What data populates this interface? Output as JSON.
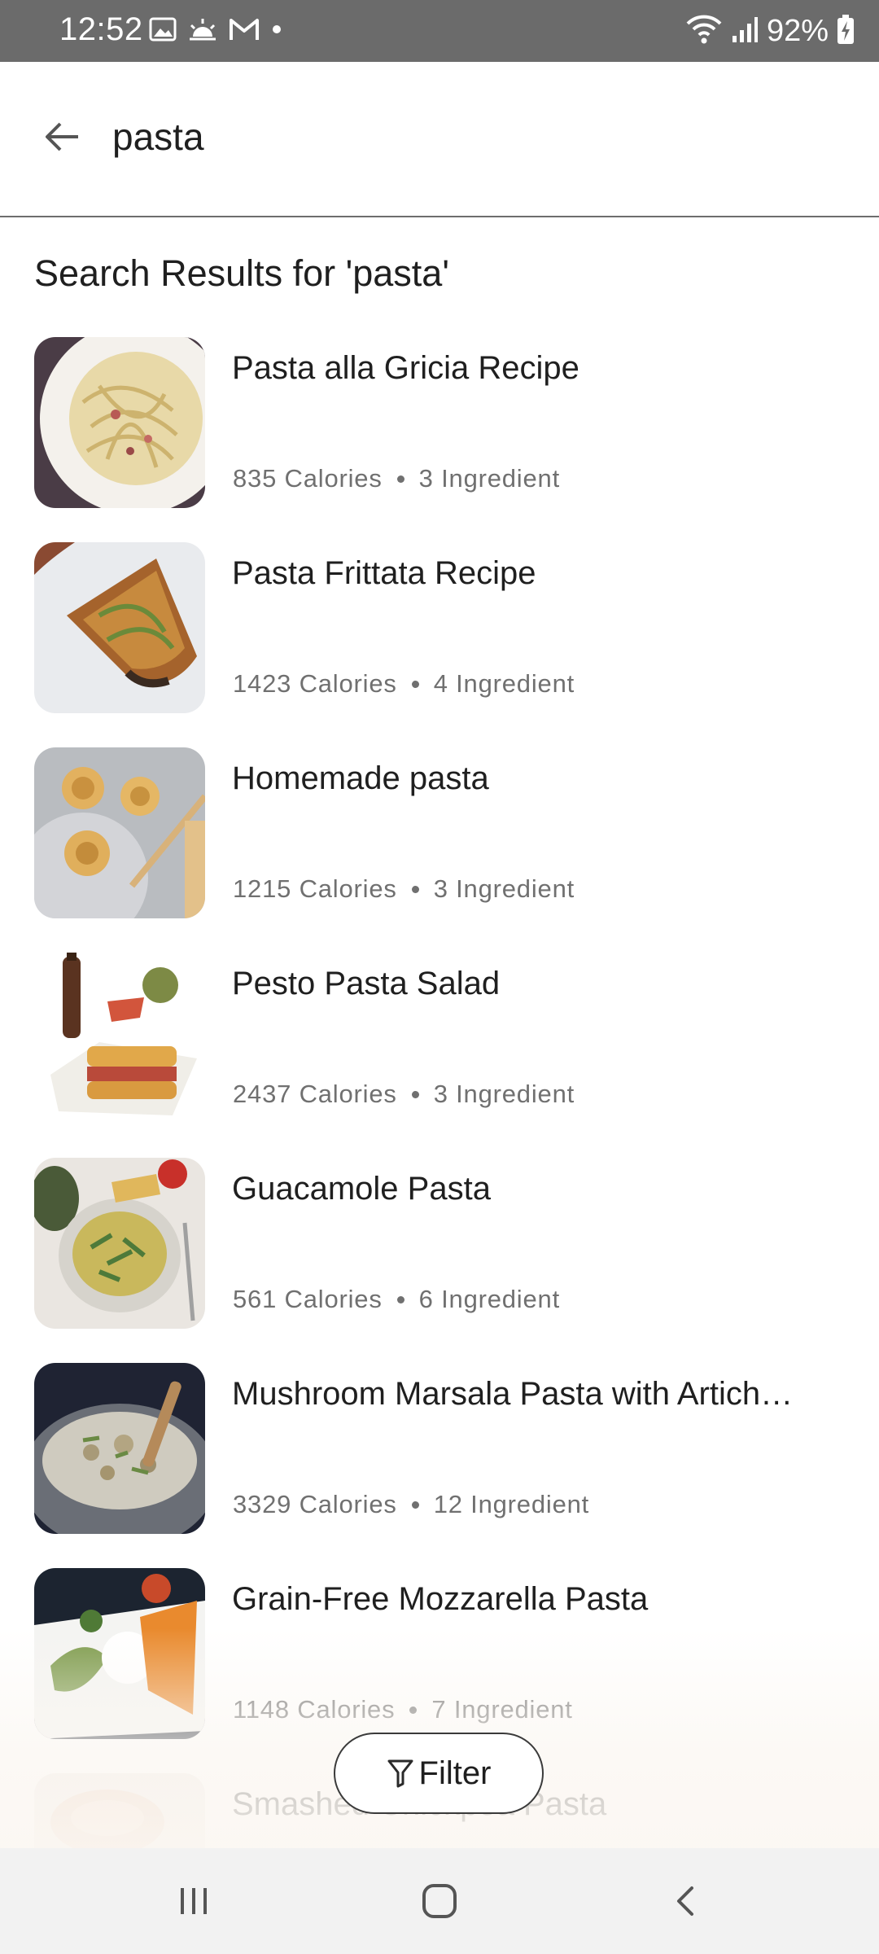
{
  "status_bar": {
    "time": "12:52",
    "battery": "92%",
    "left_icons": [
      "gallery-icon",
      "weather-icon",
      "gmail-icon",
      "dot-icon"
    ],
    "right_icons": [
      "wifi-icon",
      "signal-icon",
      "battery-charging-icon"
    ]
  },
  "search": {
    "query": "pasta",
    "back_icon": "back-arrow-icon"
  },
  "results": {
    "title": "Search Results for 'pasta'",
    "items": [
      {
        "title": "Pasta alla Gricia Recipe",
        "calories": "835 Calories",
        "ingredients": "3 Ingredient"
      },
      {
        "title": "Pasta Frittata Recipe",
        "calories": "1423 Calories",
        "ingredients": "4 Ingredient"
      },
      {
        "title": "Homemade pasta",
        "calories": "1215 Calories",
        "ingredients": "3 Ingredient"
      },
      {
        "title": "Pesto Pasta Salad",
        "calories": "2437 Calories",
        "ingredients": "3 Ingredient"
      },
      {
        "title": "Guacamole Pasta",
        "calories": "561 Calories",
        "ingredients": "6 Ingredient"
      },
      {
        "title": "Mushroom Marsala Pasta with Artich…",
        "calories": "3329 Calories",
        "ingredients": "12 Ingredient"
      },
      {
        "title": "Grain-Free Mozzarella Pasta",
        "calories": "1148 Calories",
        "ingredients": "7 Ingredient"
      },
      {
        "title": "Smashed Chickpea Pasta",
        "calories": "",
        "ingredients": ""
      }
    ]
  },
  "filter": {
    "label": "Filter",
    "icon": "filter-icon"
  },
  "nav_bar": {
    "icons": [
      "recent-apps-icon",
      "home-icon",
      "back-icon"
    ]
  },
  "colors": {
    "status_bar": "#6b6b6b",
    "meta_text": "#707070",
    "nav_bar": "#f2f2f2"
  }
}
